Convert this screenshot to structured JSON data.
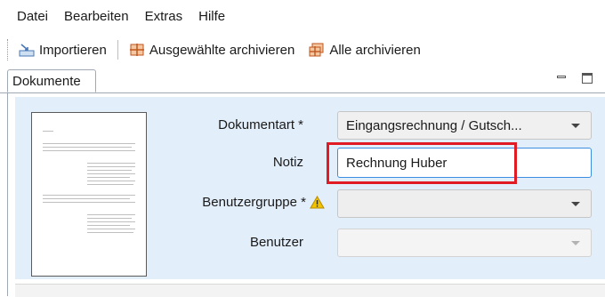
{
  "menu": {
    "items": [
      "Datei",
      "Bearbeiten",
      "Extras",
      "Hilfe"
    ]
  },
  "toolbar": {
    "import_label": "Importieren",
    "archive_selected_label": "Ausgewählte archivieren",
    "archive_all_label": "Alle archivieren"
  },
  "tab": {
    "label": "Dokumente"
  },
  "form": {
    "document_type": {
      "label": "Dokumentart *",
      "value": "Eingangsrechnung / Gutsch..."
    },
    "note": {
      "label": "Notiz",
      "value": "Rechnung Huber"
    },
    "user_group": {
      "label": "Benutzergruppe *",
      "value": ""
    },
    "user": {
      "label": "Benutzer",
      "value": ""
    }
  },
  "colors": {
    "panel_background": "#e3eefb",
    "highlight_border": "#e01b23",
    "focus_border": "#3d8ee0",
    "warning": "#f2c200"
  }
}
